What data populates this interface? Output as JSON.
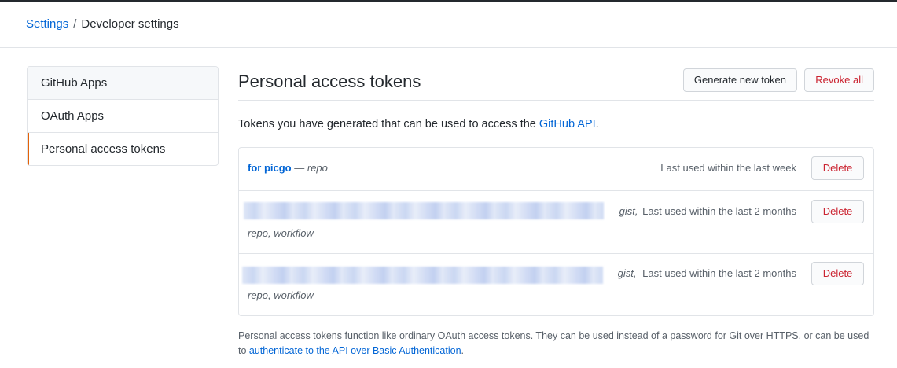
{
  "breadcrumb": {
    "parent": "Settings",
    "separator": "/",
    "current": "Developer settings"
  },
  "sidebar": {
    "items": [
      {
        "label": "GitHub Apps"
      },
      {
        "label": "OAuth Apps"
      },
      {
        "label": "Personal access tokens"
      }
    ]
  },
  "main": {
    "title": "Personal access tokens",
    "generate_label": "Generate new token",
    "revoke_label": "Revoke all",
    "desc_text": "Tokens you have generated that can be used to access the ",
    "desc_link": "GitHub API",
    "desc_end": "."
  },
  "tokens": [
    {
      "name": "for picgo",
      "dash": "—",
      "scopes": "repo",
      "last_used": "Last used within the last week",
      "delete_label": "Delete"
    },
    {
      "dash": "—",
      "scopes": "gist,",
      "scopes_more": "repo, workflow",
      "last_used": "Last used within the last 2 months",
      "delete_label": "Delete"
    },
    {
      "dash": "—",
      "scopes": "gist,",
      "scopes_more": "repo, workflow",
      "last_used": "Last used within the last 2 months",
      "delete_label": "Delete"
    }
  ],
  "footer": {
    "text": "Personal access tokens function like ordinary OAuth access tokens. They can be used instead of a password for Git over HTTPS, or can be used to ",
    "link": "authenticate to the API over Basic Authentication",
    "end": "."
  },
  "colors": {
    "link": "#0366d6",
    "danger": "#cb2431",
    "active_indicator": "#e36209",
    "border": "#e1e4e8"
  }
}
